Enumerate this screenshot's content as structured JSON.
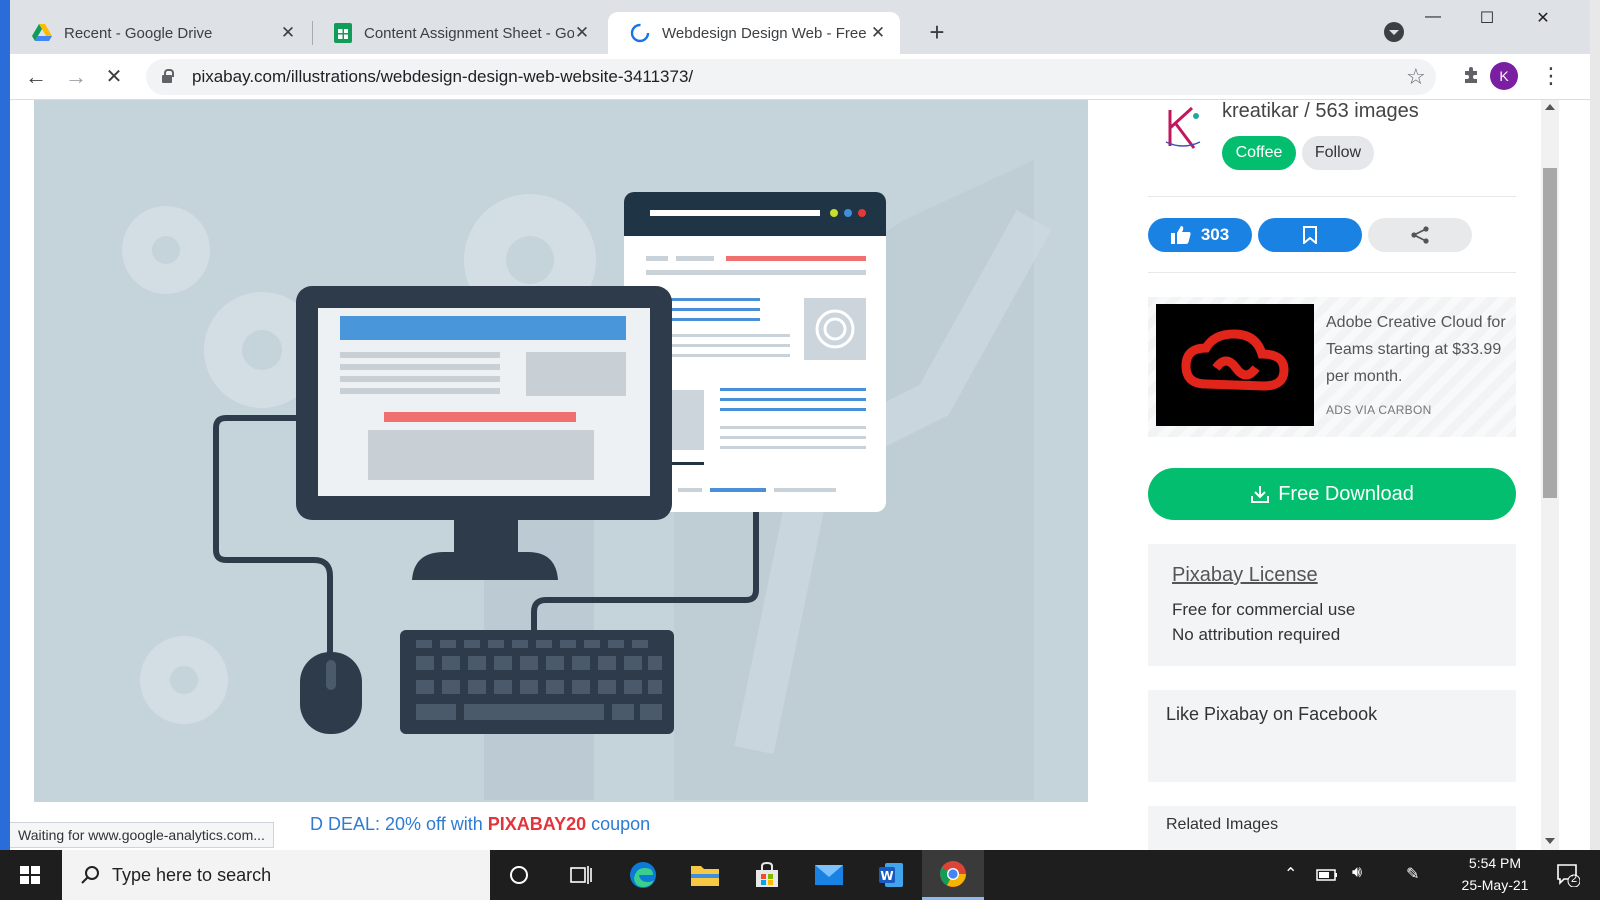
{
  "tabs": [
    {
      "title": "Recent - Google Drive",
      "icon": "google-drive-icon"
    },
    {
      "title": "Content Assignment Sheet - Goo",
      "icon": "google-sheets-icon"
    },
    {
      "title": "Webdesign Design Web - Free im",
      "icon": "loading-spinner-icon"
    }
  ],
  "address_bar": {
    "url": "pixabay.com/illustrations/webdesign-design-web-website-3411373/"
  },
  "profile": {
    "initial": "K",
    "color": "#7b1fa2"
  },
  "author": {
    "name_line": "kreatikar / 563 images",
    "coffee_label": "Coffee",
    "follow_label": "Follow"
  },
  "actions": {
    "like_count": "303"
  },
  "ad": {
    "text": "Adobe Creative Cloud for Teams starting at $33.99 per month.",
    "via": "ADS VIA CARBON"
  },
  "download": {
    "label": "Free Download"
  },
  "license": {
    "title": "Pixabay License",
    "line1": "Free for commercial use",
    "line2": "No attribution required"
  },
  "facebook": {
    "label": "Like Pixabay on Facebook"
  },
  "related": {
    "label": "Related Images"
  },
  "deal": {
    "prefix": "D DEAL: 20% off with ",
    "code": "PIXABAY20",
    "suffix": " coupon"
  },
  "status_bar": {
    "text": "Waiting for www.google-analytics.com..."
  },
  "taskbar": {
    "search_placeholder": "Type here to search",
    "time": "5:54 PM",
    "date": "25-May-21",
    "notification_count": "2"
  },
  "colors": {
    "accent_green": "#02be6e",
    "accent_blue": "#1a82e2"
  }
}
